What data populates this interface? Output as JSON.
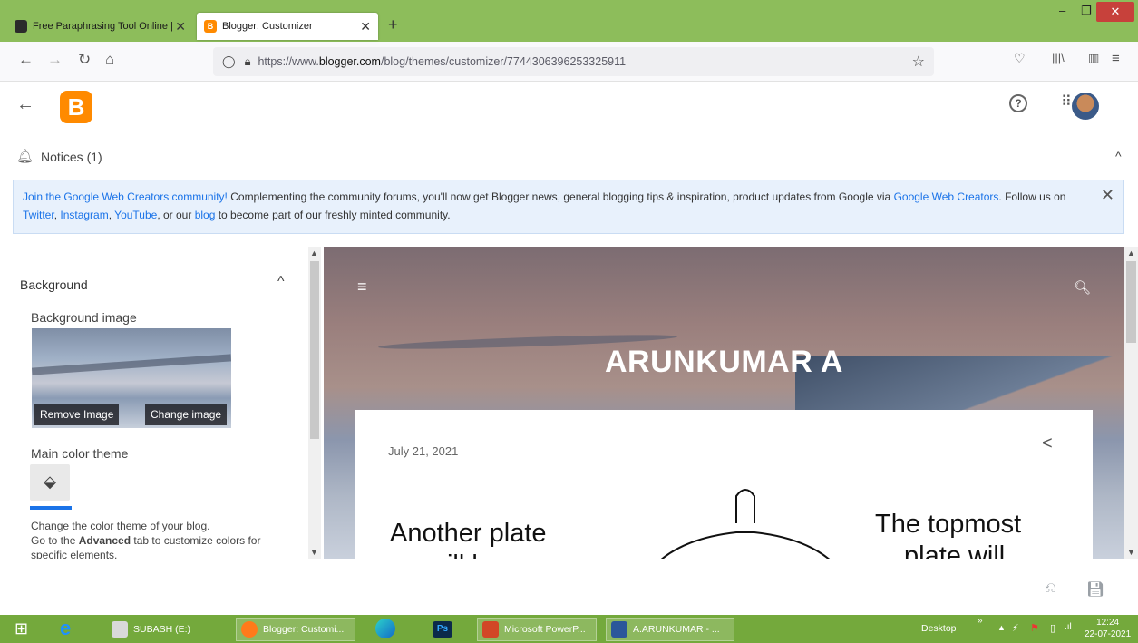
{
  "browser": {
    "tabs": [
      {
        "title": "Free Paraphrasing Tool Online | ",
        "active": false
      },
      {
        "title": "Blogger: Customizer",
        "active": true
      }
    ],
    "new_tab": "+",
    "url_prefix": "https://www.",
    "url_host": "blogger.com",
    "url_path": "/blog/themes/customizer/7744306396253325911"
  },
  "header": {
    "logo_letter": "B"
  },
  "notices": {
    "title": "Notices (1)",
    "link1": "Join the Google Web Creators community!",
    "text1": " Complementing the community forums, you'll now get Blogger news, general blogging tips & inspiration, product updates from Google via ",
    "link2": "Google Web Creators",
    "text2": ". Follow us on ",
    "link3": "Twitter",
    "sep1": ", ",
    "link4": "Instagram",
    "sep2": ", ",
    "link5": "YouTube",
    "text3": ", or our ",
    "link6": "blog",
    "text4": " to become part of our freshly minted community."
  },
  "panel": {
    "section": "Background",
    "bg_image_label": "Background image",
    "remove_image": "Remove Image",
    "change_image": "Change image",
    "theme_label": "Main color theme",
    "desc_line1": "Change the color theme of your blog.",
    "desc_line2_pre": "Go to the ",
    "desc_line2_bold": "Advanced",
    "desc_line2_post": " tab to customize colors for",
    "desc_line3": "specific elements."
  },
  "preview": {
    "blog_title": "ARUNKUMAR A",
    "post_date": "July 21, 2021",
    "img_text_left_1": "Another plate",
    "img_text_left_2": "will be",
    "img_text_right_1": "The topmost",
    "img_text_right_2": "plate will"
  },
  "taskbar": {
    "items": [
      "SUBASH (E:)",
      "Blogger: Customi...",
      "Ps",
      "Microsoft PowerP...",
      "A.ARUNKUMAR - ..."
    ],
    "desktop": "Desktop",
    "time": "12:24",
    "date": "22-07-2021"
  },
  "colors": {
    "tabbar": "#8dbd5b",
    "taskbar": "#74a93c",
    "link": "#1a73e8",
    "blogger_orange": "#ff8a00"
  }
}
